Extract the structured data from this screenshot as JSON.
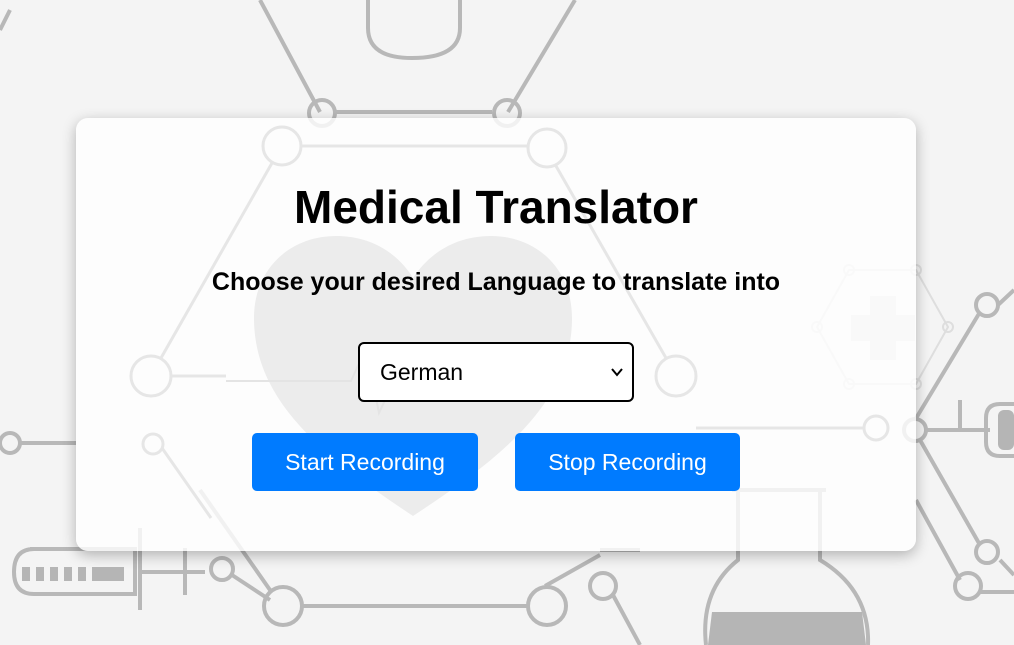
{
  "title": "Medical Translator",
  "subtitle": "Choose your desired Language to translate into",
  "language_select": {
    "selected": "German"
  },
  "buttons": {
    "start": "Start Recording",
    "stop": "Stop Recording"
  },
  "colors": {
    "button_bg": "#007bff",
    "button_text": "#ffffff",
    "background": "#f4f4f4",
    "pattern_line": "#b5b5b5"
  }
}
